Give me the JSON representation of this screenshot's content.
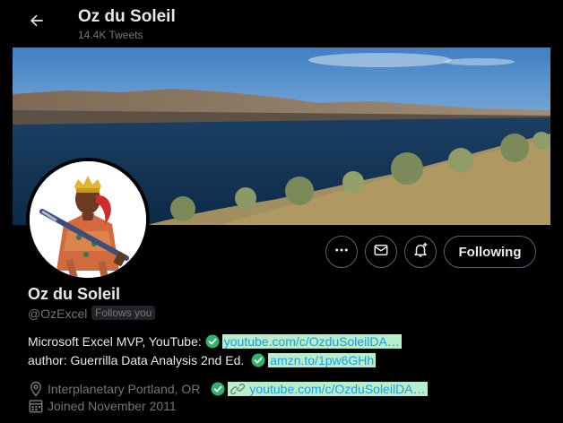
{
  "header": {
    "title": "Oz du Soleil",
    "tweet_count": "14.4K Tweets"
  },
  "icons": {
    "back": "arrow-left-icon",
    "more": "more-dots-icon",
    "message": "envelope-icon",
    "notify": "bell-plus-icon",
    "verified": "check-circle-icon",
    "link": "link-icon",
    "location": "location-pin-icon",
    "calendar": "calendar-icon"
  },
  "profile": {
    "name": "Oz du Soleil",
    "handle": "@OzExcel",
    "follows_you": "Follows you",
    "follow_button": "Following"
  },
  "bio": {
    "line1_text": "Microsoft Excel MVP, YouTube:",
    "line1_link": "youtube.com/c/OzduSoleilDA…",
    "line2_text": "author: Guerrilla Data Analysis 2nd Ed.",
    "line2_link": "amzn.to/1pw6GHh"
  },
  "meta": {
    "location": "Interplanetary Portland, OR",
    "website": "youtube.com/c/OzduSoleilDA…",
    "joined": "Joined November 2011"
  },
  "colors": {
    "background": "#000000",
    "text_primary": "#e7e9ea",
    "text_secondary": "#71767b",
    "link": "#1d9bf0",
    "link_highlight": "#b8eec9",
    "check_green": "#2fb36b",
    "border": "#536471"
  }
}
